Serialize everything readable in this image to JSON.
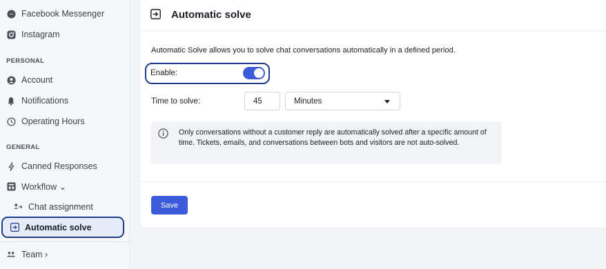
{
  "sidebar": {
    "channels": [
      {
        "label": "Facebook Messenger",
        "icon": "messenger-icon"
      },
      {
        "label": "Instagram",
        "icon": "instagram-icon"
      }
    ],
    "personal_heading": "PERSONAL",
    "personal": [
      {
        "label": "Account",
        "icon": "user-icon"
      },
      {
        "label": "Notifications",
        "icon": "bell-icon"
      },
      {
        "label": "Operating Hours",
        "icon": "clock-icon"
      }
    ],
    "general_heading": "GENERAL",
    "general": [
      {
        "label": "Canned Responses",
        "icon": "bolt-icon"
      },
      {
        "label": "Workflow ⌄",
        "icon": "workflow-icon"
      },
      {
        "label": "Chat assignment",
        "icon": "assignment-icon"
      },
      {
        "label": "Automatic solve",
        "icon": "auto-solve-icon"
      }
    ],
    "team": {
      "label": "Team ›",
      "icon": "team-icon"
    }
  },
  "main": {
    "title": "Automatic solve",
    "description": "Automatic Solve allows you to solve chat conversations automatically in a defined period.",
    "enable_label": "Enable:",
    "enable_on": true,
    "time_label": "Time to solve:",
    "time_value": "45",
    "unit_selected": "Minutes",
    "info_text": "Only conversations without a customer reply are automatically solved after a specific amount of time. Tickets, emails, and conversations between bots and visitors are not auto-solved.",
    "save_label": "Save"
  },
  "colors": {
    "accent": "#3b5bdb",
    "highlight_border": "#1e3a8a",
    "card_bg": "#ffffff",
    "page_bg": "#f2f3f6"
  }
}
